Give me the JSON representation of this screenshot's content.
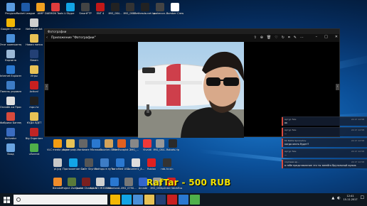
{
  "desktop": {
    "icons": [
      {
        "label": "Ресурсы",
        "color": "#5a9be0",
        "col": 0,
        "row": 0
      },
      {
        "label": "Rocket League",
        "color": "#1e5aa8",
        "col": 1,
        "row": 0
      },
      {
        "label": "AIMP",
        "color": "#f0a020",
        "col": 2,
        "row": 0
      },
      {
        "label": "DAEMON Tools Lite",
        "color": "#e13d3d",
        "col": 3,
        "row": 0
      },
      {
        "label": "Skype",
        "color": "#12a4e6",
        "col": 4,
        "row": 0
      },
      {
        "label": "SmartFTP",
        "color": "#444444",
        "col": 5,
        "row": 0
      },
      {
        "label": "ENT 4",
        "color": "#c01818",
        "col": 6,
        "row": 0
      },
      {
        "label": "IMG_084...",
        "color": "#222222",
        "col": 7,
        "row": 0
      },
      {
        "label": "IMG_088...",
        "color": "#333333",
        "col": 8,
        "row": 0
      },
      {
        "label": "Bethesda.net Launcher",
        "color": "#222222",
        "col": 9,
        "row": 0
      },
      {
        "label": "quakecon...",
        "color": "#444444",
        "col": 10,
        "row": 0
      },
      {
        "label": "Bomber Crew",
        "color": "#ffffff",
        "col": 11,
        "row": 0
      },
      {
        "label": "Google Chrome",
        "color": "#f2b705",
        "col": 0,
        "row": 1
      },
      {
        "label": "Netmaker.txt",
        "color": "#cfcfcf",
        "col": 1,
        "row": 1
      },
      {
        "label": "Этот компьютер",
        "color": "#4a8fd8",
        "col": 0,
        "row": 2
      },
      {
        "label": "Новая папка",
        "color": "#e8c255",
        "col": 1,
        "row": 2
      },
      {
        "label": "Корзина",
        "color": "#9bb8d6",
        "col": 0,
        "row": 3
      },
      {
        "label": "Steam",
        "color": "#234075",
        "col": 1,
        "row": 3
      },
      {
        "label": "Internet Explorer",
        "color": "#2a78d0",
        "col": 0,
        "row": 4
      },
      {
        "label": "Игры",
        "color": "#e8c255",
        "col": 1,
        "row": 4
      },
      {
        "label": "Панель управления",
        "color": "#3d7cc5",
        "col": 0,
        "row": 5
      },
      {
        "label": "Action!",
        "color": "#c82020",
        "col": 1,
        "row": 5
      },
      {
        "label": "Онлайн-ка Проигрыватель",
        "color": "#e0e0e0",
        "col": 0,
        "row": 6
      },
      {
        "label": "mpc-hc",
        "color": "#1f1f1f",
        "col": 1,
        "row": 6
      },
      {
        "label": "Фабрика Баннеров",
        "color": "#d84a3c",
        "col": 0,
        "row": 7
      },
      {
        "label": "КУДА ЕДЕТ",
        "color": "#e8c255",
        "col": 1,
        "row": 7
      },
      {
        "label": "Activator",
        "color": "#3a6cc0",
        "col": 0,
        "row": 8
      },
      {
        "label": "Big Organizer",
        "color": "#c02424",
        "col": 1,
        "row": 8
      },
      {
        "label": "Вход",
        "color": "#6aa4e0",
        "col": 0,
        "row": 9
      },
      {
        "label": "uTorrent",
        "color": "#4fb04a",
        "col": 1,
        "row": 9
      }
    ],
    "bottom_icons": [
      {
        "label": "VLC media player",
        "color": "#f39c12"
      },
      {
        "label": "Антиграф...",
        "color": "#e8c255"
      },
      {
        "label": "Hardware",
        "color": "#666666"
      },
      {
        "label": "Microsoft",
        "color": "#2a78d0"
      },
      {
        "label": "Counter-Strike",
        "color": "#d2a25a"
      },
      {
        "label": "The Escapist 2",
        "color": "#e06020"
      },
      {
        "label": "IMG_...",
        "color": "#888888"
      },
      {
        "label": "Vivaldi",
        "color": "#ef3939"
      },
      {
        "label": "IMG_084...",
        "color": "#999999"
      },
      {
        "label": "Robots.rip",
        "color": "#2a2a2a"
      }
    ],
    "bottom_icons_row2": [
      {
        "label": "pl.jpg",
        "color": "#c8c8c8"
      },
      {
        "label": "Приложение Скайп",
        "color": "#12a4e6"
      },
      {
        "label": "Сайт Skyrim",
        "color": "#555555"
      },
      {
        "label": "Звёзды в пути",
        "color": "#3d7cc5"
      },
      {
        "label": "Transfiled USA",
        "color": "#2a78d0"
      },
      {
        "label": "Counter1_A...",
        "color": "#dddddd"
      },
      {
        "label": "Roblox",
        "color": "#e02020"
      },
      {
        "label": "rob-hr-sin",
        "color": "#333333"
      }
    ],
    "bottom_icons_row3": [
      {
        "label": "Blender",
        "color": "#f08c2a"
      },
      {
        "label": "Project Zomboid",
        "color": "#5a7a3a"
      },
      {
        "label": "Quake Champions",
        "color": "#7a2020"
      },
      {
        "label": "ALL NO MODERN...",
        "color": "#d0d0d0"
      },
      {
        "label": "download...",
        "color": "#2a78d0"
      },
      {
        "label": "IMG_0790...",
        "color": "#777777"
      },
      {
        "label": "Arcade",
        "color": "#3366cc"
      },
      {
        "label": "IMG_081...",
        "color": "#999999"
      },
      {
        "label": "Splinter Workflow",
        "color": "#cc2222"
      }
    ]
  },
  "photos_window": {
    "window_title": "Фотографии",
    "app_title": "Приложение \"Фотографии\"",
    "toolbar_icons": [
      "share-icon",
      "zoom-icon",
      "delete-icon",
      "favorite-icon",
      "rotate-icon",
      "crop-icon",
      "edit-icon",
      "more-icon"
    ]
  },
  "notifications": [
    {
      "from": "Артур Тим",
      "time": "22.17 12:58",
      "message": "ок"
    },
    {
      "from": "Артур Тим",
      "time": "22.17 12:58",
      "message": "..."
    },
    {
      "from": "Mr Nikita Sprukahov",
      "time": "22.17 12:58",
      "message": "когда опять будет?"
    },
    {
      "from": "Артур Тим",
      "time": "22.17 12:58",
      "message": "..."
    },
    {
      "from": "скупаем ар...",
      "time": "22.17 12:58",
      "message": "в тебе представление что ты занейго брутальный мужик"
    }
  ],
  "watermark": "RafTar - 500 RUB",
  "taskbar": {
    "search_placeholder": "",
    "apps": [
      "#f2b705",
      "#12a4e6",
      "#4a8fd8",
      "#e8c255",
      "#234075",
      "#c82020",
      "#2a78d0",
      "#4fb04a"
    ],
    "clock_time": "12:41",
    "clock_date": "15.11.2017"
  }
}
